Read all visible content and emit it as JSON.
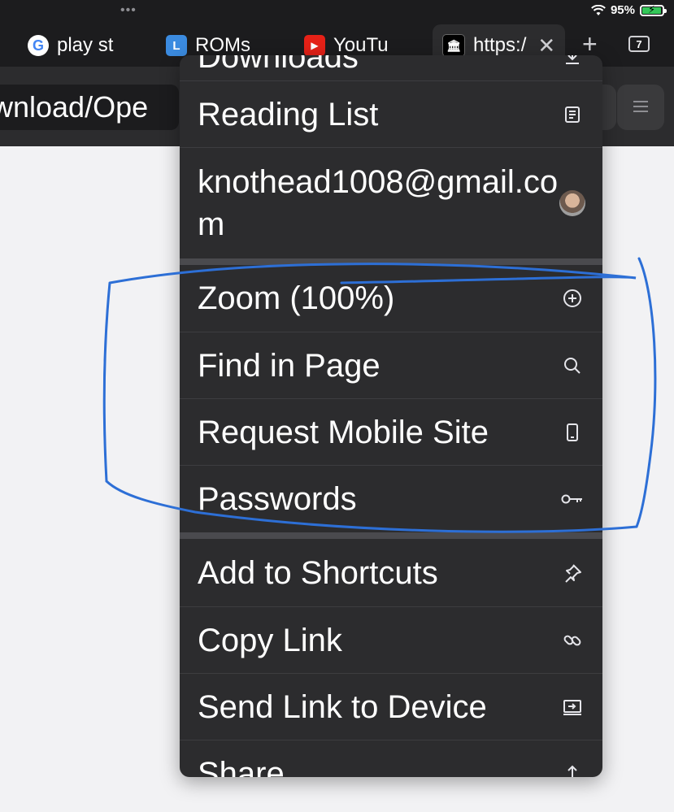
{
  "status_bar": {
    "battery_percent": "95%",
    "battery_level": 0.95
  },
  "tabs": [
    {
      "title": "play st",
      "favicon": "google-g"
    },
    {
      "title": "ROMs",
      "favicon": "letter-l"
    },
    {
      "title": "YouTu",
      "favicon": "youtube"
    },
    {
      "title": "https:/",
      "favicon": "museum"
    }
  ],
  "tab_count": "7",
  "url_text": "wnload/Ope",
  "menu": {
    "items_top": [
      {
        "label": "Downloads",
        "icon": "download-icon"
      },
      {
        "label": "Reading List",
        "icon": "reading-list-icon"
      },
      {
        "label": "knothead1008@gmail.com",
        "icon": "avatar"
      }
    ],
    "items_mid": [
      {
        "label": "Zoom (100%)",
        "icon": "zoom-in-icon"
      },
      {
        "label": "Find in Page",
        "icon": "search-icon"
      },
      {
        "label": "Request Mobile Site",
        "icon": "phone-icon"
      },
      {
        "label": "Passwords",
        "icon": "key-icon"
      }
    ],
    "items_bottom": [
      {
        "label": "Add to Shortcuts",
        "icon": "pin-icon"
      },
      {
        "label": "Copy Link",
        "icon": "link-icon"
      },
      {
        "label": "Send Link to Device",
        "icon": "send-to-device-icon"
      },
      {
        "label": "Share",
        "icon": "share-icon"
      }
    ]
  },
  "annotation_color": "#2d6fd6"
}
